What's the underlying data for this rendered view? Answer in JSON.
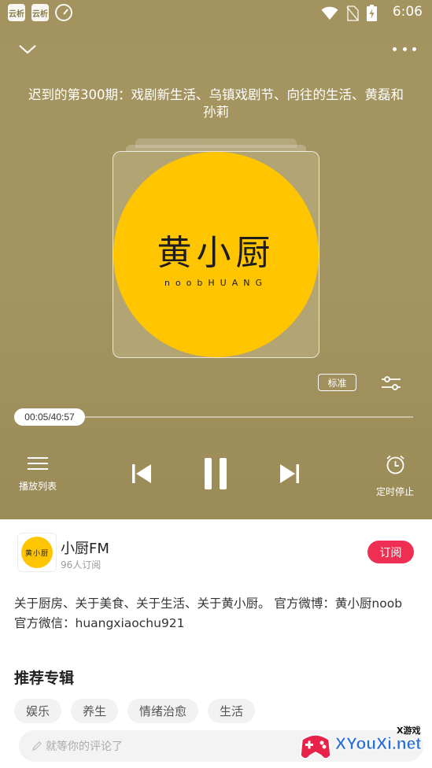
{
  "status_bar": {
    "app1_label": "云析",
    "app2_label": "云析",
    "time": "6:06",
    "icons": [
      "app-icon",
      "app-icon",
      "gauge-icon",
      "wifi-icon",
      "no-sim-icon",
      "battery-charging-icon"
    ]
  },
  "player": {
    "episode_title": "迟到的第300期：戏剧新生活、乌镇戏剧节、向往的生活、黄磊和孙莉",
    "cover": {
      "brand_text": "黄小厨",
      "brand_subtext": "noobHUANG",
      "background_color": "#fec500"
    },
    "quality_label": "标准",
    "current_time": "00:05/40:57",
    "progress_fraction": 0.0021,
    "controls": {
      "playlist_label": "播放列表",
      "timer_label": "定时停止"
    },
    "background_color": "#a3935f"
  },
  "channel": {
    "logo_text": "黄小厨",
    "name": "小厨FM",
    "subscribers": "96人订阅",
    "subscribe_label": "订阅",
    "accent_color": "#ee2e52"
  },
  "description": {
    "line1": "关于厨房、关于美食、关于生活、关于黄小厨。 官方微博：黄小厨noob",
    "line2": "官方微信：huangxiaochu921"
  },
  "recommended": {
    "title": "推荐专辑",
    "tags": [
      "娱乐",
      "养生",
      "情绪治愈",
      "生活"
    ]
  },
  "comment": {
    "placeholder": "就等你的评论了"
  },
  "watermark": {
    "text": "XYouXi.net",
    "tag": "X游戏"
  }
}
